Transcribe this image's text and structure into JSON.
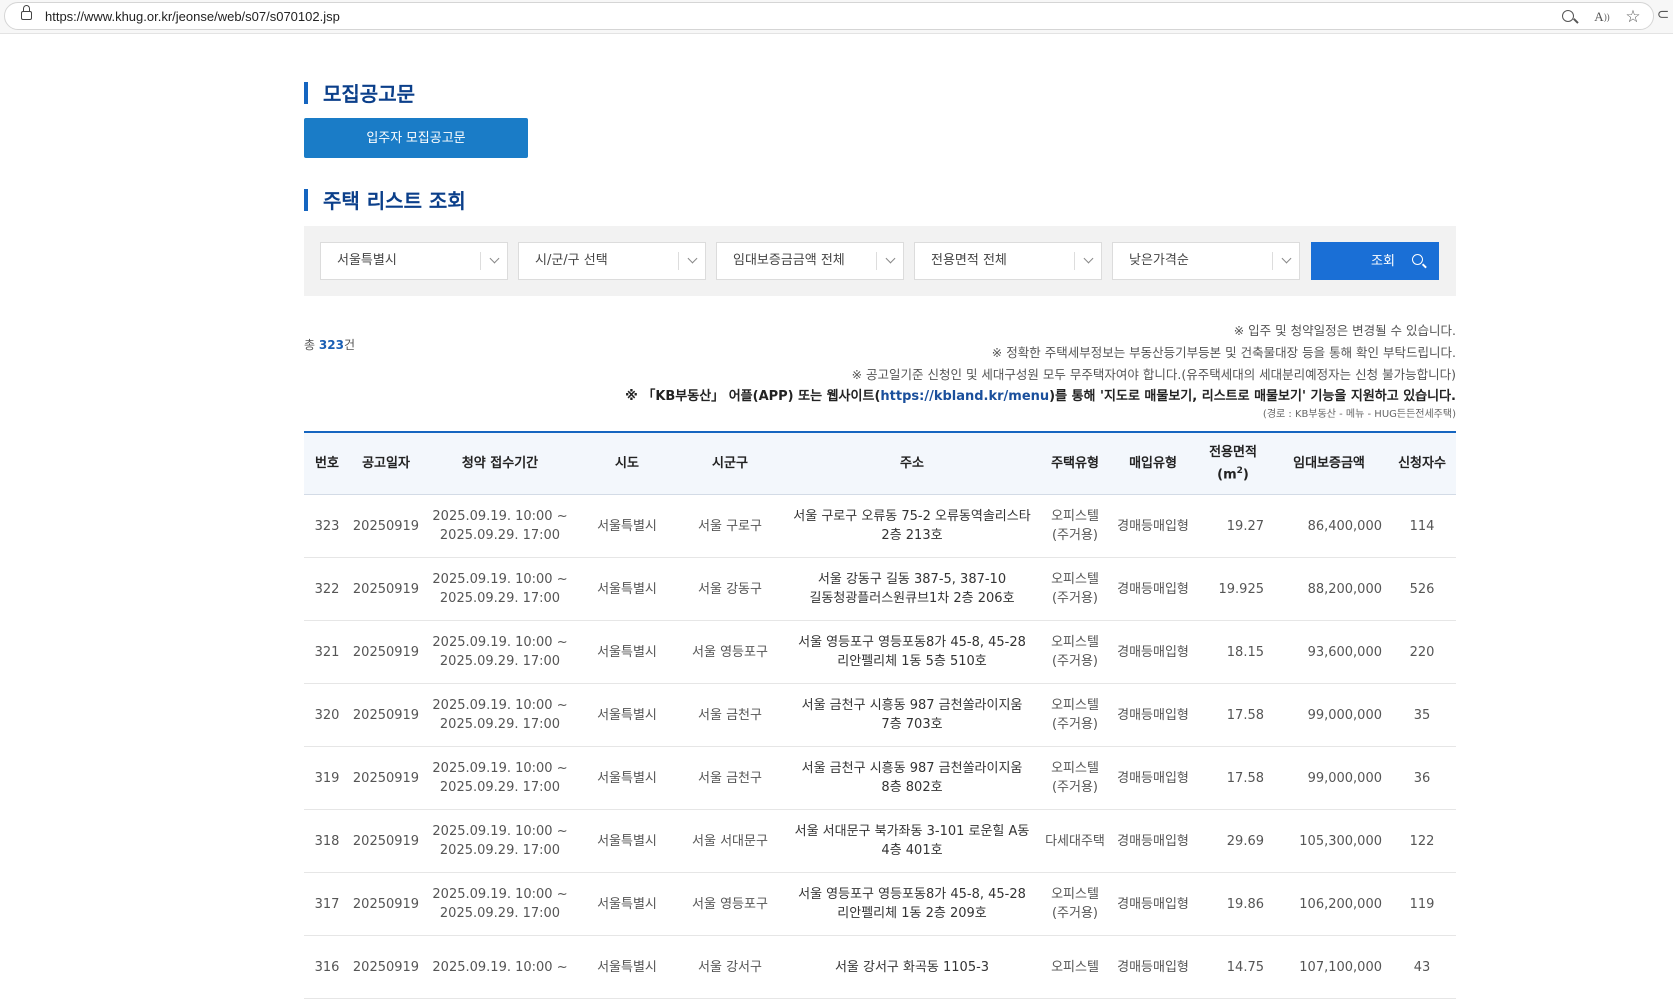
{
  "browser": {
    "url": "https://www.khug.or.kr/jeonse/web/s07/s070102.jsp"
  },
  "recruit": {
    "title": "모집공고문",
    "button_label": "입주자 모집공고문"
  },
  "search": {
    "title": "주택 리스트 조회",
    "filters": {
      "sido": "서울특별시",
      "sigungu": "시/군/구 선택",
      "deposit": "임대보증금금액 전체",
      "area": "전용면적 전체",
      "sort": "낮은가격순"
    },
    "button_label": "조회"
  },
  "total": {
    "prefix": "총",
    "count": "323",
    "suffix": "건"
  },
  "notes": {
    "n1": "※ 입주 및 청약일정은 변경될 수 있습니다.",
    "n2": "※ 정확한 주택세부정보는 부동산등기부등본 및 건축물대장 등을 통해 확인 부탁드립니다.",
    "n3": "※ 공고일기준 신청인 및 세대구성원 모두 무주택자여야 합니다.(유주택세대의 세대분리예정자는 신청 불가능합니다)",
    "kb_before": "※ 「KB부동산」 어플(APP) 또는 웹사이트(",
    "kb_link": "https://kbland.kr/menu",
    "kb_after": ")를 통해 '지도로 매물보기, 리스트로 매물보기' 기능을 지원하고 있습니다.",
    "path": "(경로 : KB부동산 - 메뉴 - HUG든든전세주택)"
  },
  "table": {
    "headers": {
      "no": "번호",
      "date": "공고일자",
      "period": "청약 접수기간",
      "sido": "시도",
      "sigungu": "시군구",
      "address": "주소",
      "type": "주택유형",
      "purchase": "매입유형",
      "area_a": "전용면적",
      "area_b": "(m",
      "area_sup": "2",
      "area_c": ")",
      "deposit": "임대보증금액",
      "applicants": "신청자수"
    },
    "rows": [
      {
        "no": "323",
        "date": "20250919",
        "p1": "2025.09.19. 10:00 ~",
        "p2": "2025.09.29. 17:00",
        "sido": "서울특별시",
        "sigungu": "서울 구로구",
        "a1": "서울 구로구 오류동 75-2 오류동역솔리스타",
        "a2": "2층 213호",
        "t1": "오피스텔",
        "t2": "(주거용)",
        "purchase": "경매등매입형",
        "area": "19.27",
        "deposit": "86,400,000",
        "applicants": "114"
      },
      {
        "no": "322",
        "date": "20250919",
        "p1": "2025.09.19. 10:00 ~",
        "p2": "2025.09.29. 17:00",
        "sido": "서울특별시",
        "sigungu": "서울 강동구",
        "a1": "서울 강동구 길동 387-5, 387-10",
        "a2": "길동청광플러스원큐브1차 2층 206호",
        "t1": "오피스텔",
        "t2": "(주거용)",
        "purchase": "경매등매입형",
        "area": "19.925",
        "deposit": "88,200,000",
        "applicants": "526"
      },
      {
        "no": "321",
        "date": "20250919",
        "p1": "2025.09.19. 10:00 ~",
        "p2": "2025.09.29. 17:00",
        "sido": "서울특별시",
        "sigungu": "서울 영등포구",
        "a1": "서울 영등포구 영등포동8가 45-8, 45-28",
        "a2": "리안펠리체 1동 5층 510호",
        "t1": "오피스텔",
        "t2": "(주거용)",
        "purchase": "경매등매입형",
        "area": "18.15",
        "deposit": "93,600,000",
        "applicants": "220"
      },
      {
        "no": "320",
        "date": "20250919",
        "p1": "2025.09.19. 10:00 ~",
        "p2": "2025.09.29. 17:00",
        "sido": "서울특별시",
        "sigungu": "서울 금천구",
        "a1": "서울 금천구 시흥동 987 금천쏠라이지움",
        "a2": "7층 703호",
        "t1": "오피스텔",
        "t2": "(주거용)",
        "purchase": "경매등매입형",
        "area": "17.58",
        "deposit": "99,000,000",
        "applicants": "35"
      },
      {
        "no": "319",
        "date": "20250919",
        "p1": "2025.09.19. 10:00 ~",
        "p2": "2025.09.29. 17:00",
        "sido": "서울특별시",
        "sigungu": "서울 금천구",
        "a1": "서울 금천구 시흥동 987 금천쏠라이지움",
        "a2": "8층 802호",
        "t1": "오피스텔",
        "t2": "(주거용)",
        "purchase": "경매등매입형",
        "area": "17.58",
        "deposit": "99,000,000",
        "applicants": "36"
      },
      {
        "no": "318",
        "date": "20250919",
        "p1": "2025.09.19. 10:00 ~",
        "p2": "2025.09.29. 17:00",
        "sido": "서울특별시",
        "sigungu": "서울 서대문구",
        "a1": "서울 서대문구 북가좌동 3-101 로운힐 A동",
        "a2": "4층 401호",
        "t1": "다세대주택",
        "t2": "",
        "purchase": "경매등매입형",
        "area": "29.69",
        "deposit": "105,300,000",
        "applicants": "122"
      },
      {
        "no": "317",
        "date": "20250919",
        "p1": "2025.09.19. 10:00 ~",
        "p2": "2025.09.29. 17:00",
        "sido": "서울특별시",
        "sigungu": "서울 영등포구",
        "a1": "서울 영등포구 영등포동8가 45-8, 45-28",
        "a2": "리안펠리체 1동 2층 209호",
        "t1": "오피스텔",
        "t2": "(주거용)",
        "purchase": "경매등매입형",
        "area": "19.86",
        "deposit": "106,200,000",
        "applicants": "119"
      },
      {
        "no": "316",
        "date": "20250919",
        "p1": "2025.09.19. 10:00 ~",
        "p2": "",
        "sido": "서울특별시",
        "sigungu": "서울 강서구",
        "a1": "서울 강서구 화곡동 1105-3",
        "a2": "",
        "t1": "오피스텔",
        "t2": "",
        "purchase": "경매등매입형",
        "area": "14.75",
        "deposit": "107,100,000",
        "applicants": "43"
      }
    ]
  },
  "icons": {
    "lock": "lock-icon",
    "zoom": "zoom-icon",
    "read_aloud": "read-aloud-icon",
    "favorite": "star-icon",
    "extensions": "extensions-icon",
    "search": "search-icon",
    "dropdown": "chevron-down-icon"
  },
  "colors": {
    "title": "#0b3f8a",
    "title_bar": "#1565c0",
    "recruit_button": "#1a7cc7",
    "search_button": "#1a6fd6",
    "count": "#1a5fb4",
    "table_border": "#1565c0",
    "header_bg": "#f3f7fc"
  }
}
